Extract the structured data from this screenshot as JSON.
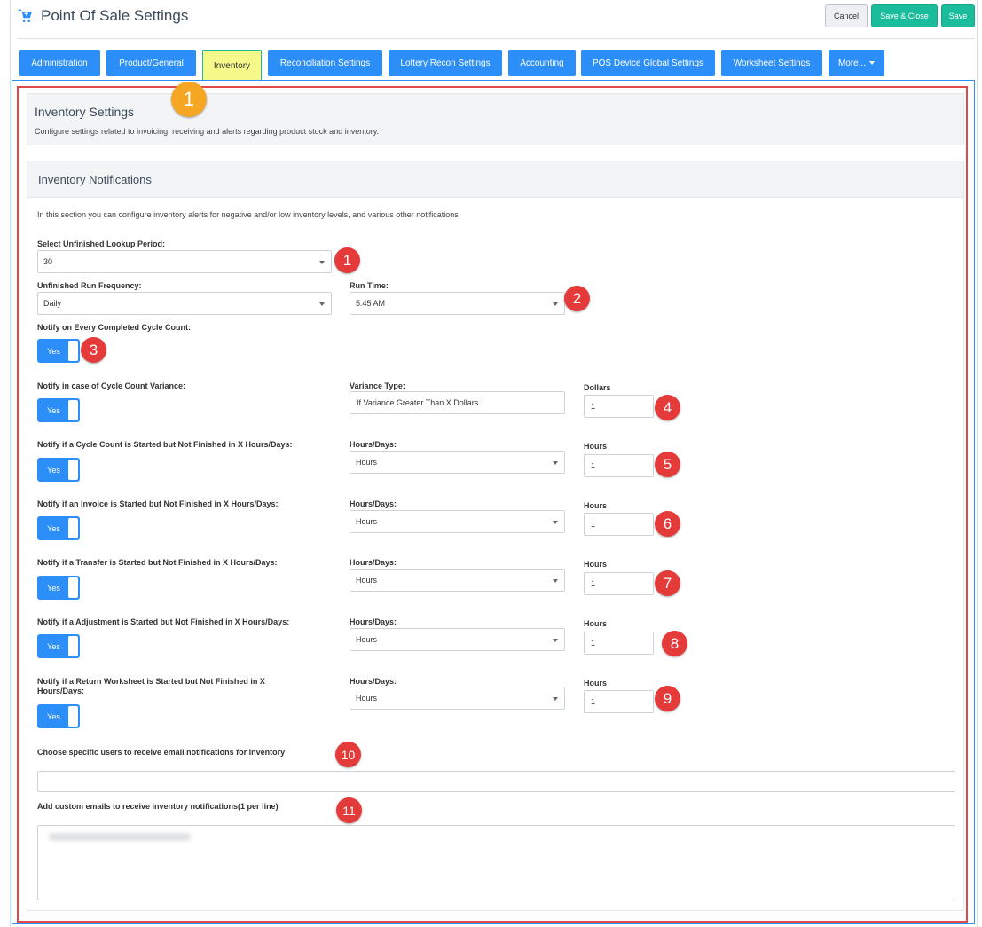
{
  "app": {
    "title": "Point Of Sale Settings",
    "icon": "shopping-cart-icon"
  },
  "toolbar": {
    "cancel_label": "Cancel",
    "save_close_label": "Save & Close",
    "save_label": "Save"
  },
  "tabs": [
    {
      "label": "Administration"
    },
    {
      "label": "Product/General"
    },
    {
      "label": "Inventory",
      "active": true
    },
    {
      "label": "Reconciliation Settings"
    },
    {
      "label": "Lottery Recon Settings"
    },
    {
      "label": "Accounting"
    },
    {
      "label": "POS Device Global Settings"
    },
    {
      "label": "Worksheet Settings"
    },
    {
      "label": "More..."
    }
  ],
  "inventory_settings": {
    "title": "Inventory Settings",
    "description": "Configure settings related to invoicing, receiving and alerts regarding product stock and inventory."
  },
  "notifications": {
    "title": "Inventory Notifications",
    "description": "In this section you can configure inventory alerts for negative and/or low inventory levels, and various other notifications",
    "lookup_period": {
      "label": "Select Unfinished Lookup Period:",
      "value": "30"
    },
    "run_frequency": {
      "label": "Unfinished Run Frequency:",
      "value": "Daily"
    },
    "run_time": {
      "label": "Run Time:",
      "value": "5:45 AM"
    },
    "cycle_complete": {
      "label": "Notify on Every Completed Cycle Count:",
      "toggle": "Yes"
    },
    "variance": {
      "label": "Notify in case of Cycle Count Variance:",
      "toggle": "Yes",
      "type_label": "Variance Type:",
      "type_value": "If Variance Greater Than X Dollars",
      "amount_label": "Dollars",
      "amount_value": "1"
    },
    "rows": [
      {
        "label": "Notify if a Cycle Count is Started but Not Finished in X Hours/Days:",
        "toggle": "Yes",
        "unit_label": "Hours/Days:",
        "unit_value": "Hours",
        "amount_label": "Hours",
        "amount_value": "1"
      },
      {
        "label": "Notify if an Invoice is Started but Not Finished in X Hours/Days:",
        "toggle": "Yes",
        "unit_label": "Hours/Days:",
        "unit_value": "Hours",
        "amount_label": "Hours",
        "amount_value": "1"
      },
      {
        "label": "Notify if a Transfer is Started but Not Finished in X Hours/Days:",
        "toggle": "Yes",
        "unit_label": "Hours/Days:",
        "unit_value": "Hours",
        "amount_label": "Hours",
        "amount_value": "1"
      },
      {
        "label": "Notify if a Adjustment is Started but Not Finished in X Hours/Days:",
        "toggle": "Yes",
        "unit_label": "Hours/Days:",
        "unit_value": "Hours",
        "amount_label": "Hours",
        "amount_value": "1"
      },
      {
        "label": "Notify if a Return Worksheet is Started but Not Finished in X Hours/Days:",
        "toggle": "Yes",
        "unit_label": "Hours/Days:",
        "unit_value": "Hours",
        "amount_label": "Hours",
        "amount_value": "1"
      }
    ],
    "users_label": "Choose specific users to receive email notifications for inventory",
    "emails_label": "Add custom emails to receive inventory notifications(1 per line)"
  },
  "callouts": {
    "section": "1",
    "items": [
      "1",
      "2",
      "3",
      "4",
      "5",
      "6",
      "7",
      "8",
      "9",
      "10",
      "11"
    ]
  },
  "colors": {
    "primary": "#2c8ef8",
    "success": "#1abc9c",
    "active_tab": "#f5f98a",
    "callout_red": "#e53a3a",
    "callout_orange": "#f5a623",
    "highlight_frame": "#e24a4a"
  }
}
